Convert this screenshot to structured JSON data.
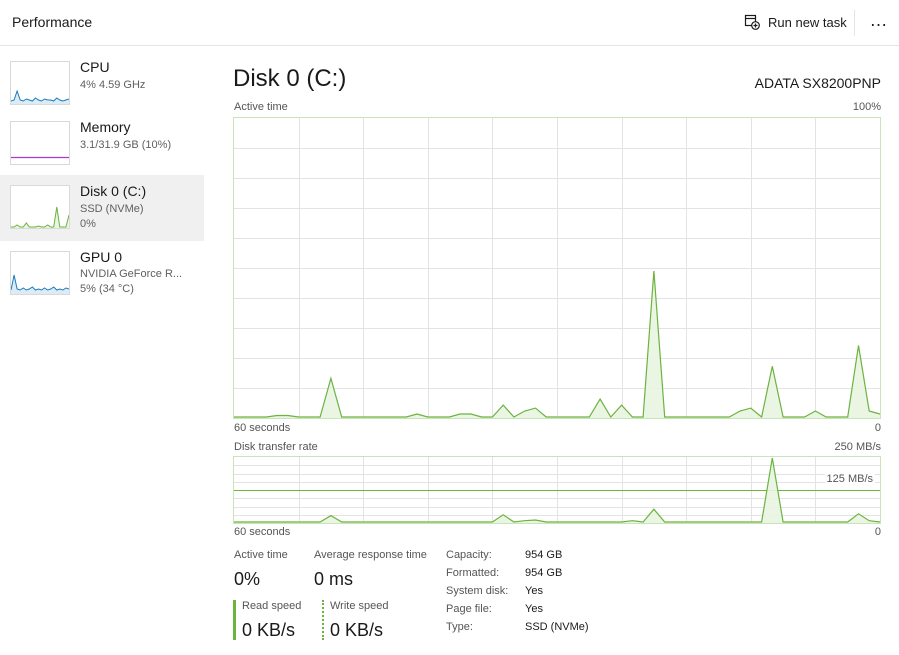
{
  "header": {
    "title": "Performance",
    "run_new_task": "Run new task",
    "more_label": "…",
    "run_icon": "run-task-icon",
    "more_icon": "more-icon"
  },
  "sidebar": {
    "items": [
      {
        "name": "CPU",
        "sub1": "4%  4.59 GHz",
        "sub2": "",
        "color": "#1a7bbf",
        "selected": false
      },
      {
        "name": "Memory",
        "sub1": "3.1/31.9 GB (10%)",
        "sub2": "",
        "color": "#a43ec6",
        "selected": false
      },
      {
        "name": "Disk 0 (C:)",
        "sub1": "SSD (NVMe)",
        "sub2": "0%",
        "color": "#6cb33f",
        "selected": true
      },
      {
        "name": "GPU 0",
        "sub1": "NVIDIA GeForce R...",
        "sub2": "5%  (34 °C)",
        "color": "#1a7bbf",
        "selected": false
      }
    ]
  },
  "main": {
    "title": "Disk 0 (C:)",
    "model": "ADATA SX8200PNP",
    "active_chart": {
      "label": "Active time",
      "max_label": "100%",
      "x_left": "60 seconds",
      "x_right": "0"
    },
    "transfer_chart": {
      "label": "Disk transfer rate",
      "max_label": "250 MB/s",
      "mid_label": "125 MB/s",
      "x_left": "60 seconds",
      "x_right": "0"
    },
    "stats": {
      "active_time_label": "Active time",
      "active_time_value": "0%",
      "avg_response_label": "Average response time",
      "avg_response_value": "0 ms",
      "read_speed_label": "Read speed",
      "read_speed_value": "0 KB/s",
      "write_speed_label": "Write speed",
      "write_speed_value": "0 KB/s"
    },
    "info": [
      {
        "key": "Capacity:",
        "value": "954 GB"
      },
      {
        "key": "Formatted:",
        "value": "954 GB"
      },
      {
        "key": "System disk:",
        "value": "Yes"
      },
      {
        "key": "Page file:",
        "value": "Yes"
      },
      {
        "key": "Type:",
        "value": "SSD (NVMe)"
      }
    ]
  },
  "colors": {
    "disk_green": "#6cb33f",
    "disk_fill": "#e8f4e0",
    "grid": "#e3e3e3"
  },
  "chart_data": [
    {
      "type": "area",
      "title": "Active time",
      "xlabel": "60 seconds",
      "ylim": [
        0,
        100
      ],
      "x": [
        60,
        59,
        58,
        57,
        56,
        55,
        54,
        53,
        52,
        51,
        50,
        49,
        48,
        47,
        46,
        45,
        44,
        43,
        42,
        41,
        40,
        39,
        38,
        37,
        36,
        35,
        34,
        33,
        32,
        31,
        30,
        29,
        28,
        27,
        26,
        25,
        24,
        23,
        22,
        21,
        20,
        19,
        18,
        17,
        16,
        15,
        14,
        13,
        12,
        11,
        10,
        9,
        8,
        7,
        6,
        5,
        4,
        3,
        2,
        1,
        0
      ],
      "series": [
        {
          "values": [
            0,
            0,
            0,
            0,
            0.5,
            0.5,
            0,
            0,
            0,
            13,
            0,
            0,
            0,
            0,
            0,
            0,
            0,
            1,
            0,
            0,
            0,
            1,
            1,
            0,
            0,
            4,
            0,
            2,
            3,
            0,
            0,
            0,
            0,
            0,
            6,
            0,
            4,
            0,
            0,
            49,
            0,
            0,
            0,
            0,
            0,
            0,
            0,
            2,
            3,
            0,
            17,
            0,
            0,
            0,
            2,
            0,
            0,
            0,
            24,
            2,
            1
          ]
        }
      ]
    },
    {
      "type": "line",
      "title": "Disk transfer rate",
      "ylim": [
        0,
        250
      ],
      "x": [
        60,
        59,
        58,
        57,
        56,
        55,
        54,
        53,
        52,
        51,
        50,
        49,
        48,
        47,
        46,
        45,
        44,
        43,
        42,
        41,
        40,
        39,
        38,
        37,
        36,
        35,
        34,
        33,
        32,
        31,
        30,
        29,
        28,
        27,
        26,
        25,
        24,
        23,
        22,
        21,
        20,
        19,
        18,
        17,
        16,
        15,
        14,
        13,
        12,
        11,
        10,
        9,
        8,
        7,
        6,
        5,
        4,
        3,
        2,
        1,
        0
      ],
      "series": [
        {
          "values": [
            0,
            0,
            0,
            0,
            0,
            0,
            0,
            0,
            0,
            25,
            0,
            0,
            0,
            0,
            0,
            0,
            0,
            0,
            0,
            0,
            0,
            0,
            0,
            0,
            0,
            28,
            0,
            5,
            8,
            0,
            0,
            0,
            0,
            0,
            0,
            0,
            0,
            5,
            0,
            50,
            0,
            0,
            0,
            0,
            0,
            0,
            0,
            0,
            0,
            0,
            250,
            0,
            0,
            0,
            0,
            0,
            0,
            0,
            32,
            5,
            0
          ]
        }
      ]
    }
  ]
}
